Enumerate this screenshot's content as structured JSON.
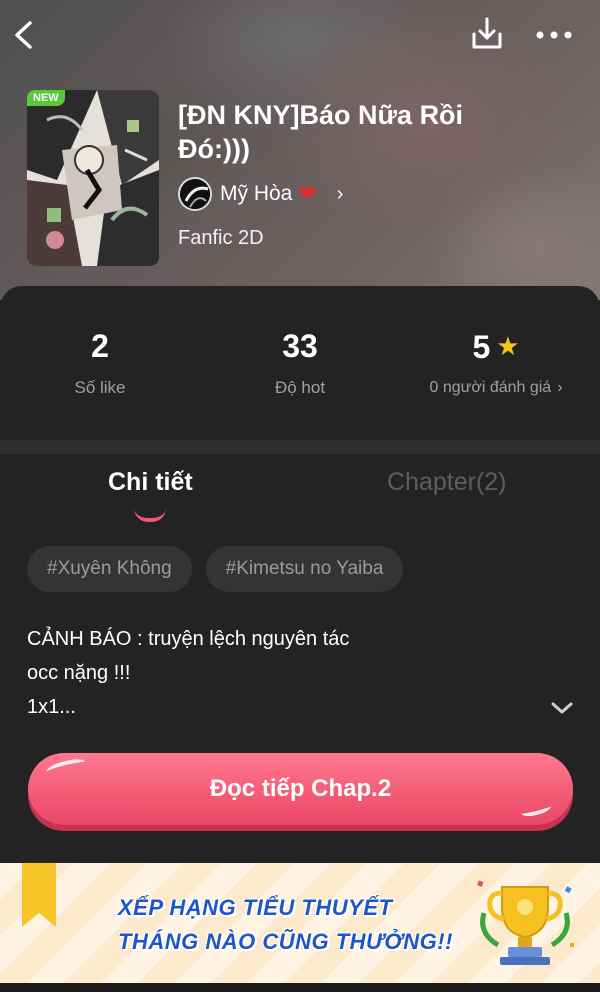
{
  "header": {
    "back_icon": "chevron-left-icon",
    "download_icon": "download-icon",
    "more_icon": "more-dots-icon"
  },
  "story": {
    "badge": "NEW",
    "title": "[ĐN KNY]Báo Nữa Rồi Đó:)))",
    "author": "Mỹ Hòa",
    "author_suffix": "❤️",
    "category": "Fanfic 2D"
  },
  "stats": {
    "likes_value": "2",
    "likes_label": "Số like",
    "hot_value": "33",
    "hot_label": "Độ hot",
    "rating_value": "5",
    "rating_label": "0 người đánh giá"
  },
  "tabs": {
    "details": "Chi tiết",
    "chapters": "Chapter(2)"
  },
  "tags": [
    "#Xuyên Không",
    "#Kimetsu no Yaiba"
  ],
  "description": {
    "line1": "CẢNH BÁO : truyện lệch nguyên tác",
    "line2": "occ nặng !!!",
    "line3": "1x1..."
  },
  "cta": {
    "label": "Đọc tiếp Chap.2"
  },
  "banner": {
    "line1": "XẾP HẠNG TIỂU THUYẾT",
    "line2": "THÁNG NÀO CŨNG THƯỞNG!!"
  },
  "colors": {
    "accent": "#f25a75",
    "star": "#f5c518",
    "new_badge": "#58c93a",
    "banner_text": "#1e56c8"
  }
}
